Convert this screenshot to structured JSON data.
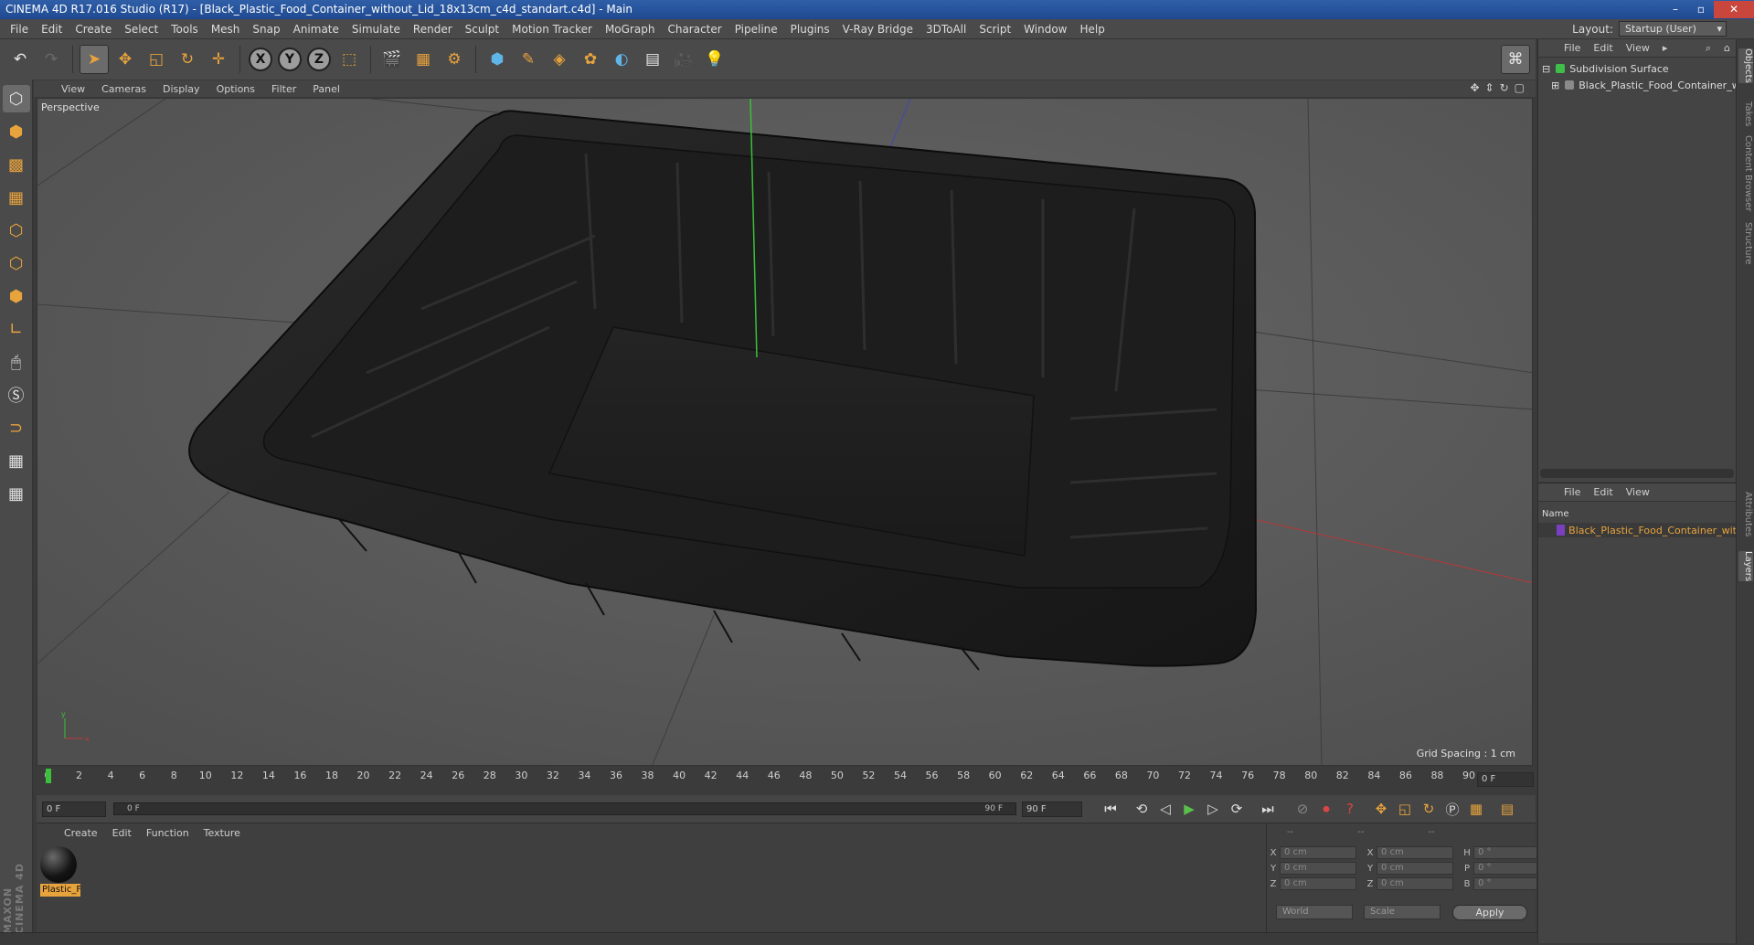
{
  "window": {
    "title": "CINEMA 4D R17.016 Studio (R17) - [Black_Plastic_Food_Container_without_Lid_18x13cm_c4d_standart.c4d] - Main"
  },
  "menu": [
    "File",
    "Edit",
    "Create",
    "Select",
    "Tools",
    "Mesh",
    "Snap",
    "Animate",
    "Simulate",
    "Render",
    "Sculpt",
    "Motion Tracker",
    "MoGraph",
    "Character",
    "Pipeline",
    "Plugins",
    "V-Ray Bridge",
    "3DToAll",
    "Script",
    "Window",
    "Help"
  ],
  "layout": {
    "label": "Layout:",
    "value": "Startup (User)"
  },
  "viewport": {
    "menu": [
      "View",
      "Cameras",
      "Display",
      "Options",
      "Filter",
      "Panel"
    ],
    "camera_label": "Perspective",
    "grid_spacing": "Grid Spacing : 1 cm"
  },
  "timeline": {
    "ticks": [
      "0",
      "2",
      "4",
      "6",
      "8",
      "10",
      "12",
      "14",
      "16",
      "18",
      "20",
      "22",
      "24",
      "26",
      "28",
      "30",
      "32",
      "34",
      "36",
      "38",
      "40",
      "42",
      "44",
      "46",
      "48",
      "50",
      "52",
      "54",
      "56",
      "58",
      "60",
      "62",
      "64",
      "66",
      "68",
      "70",
      "72",
      "74",
      "76",
      "78",
      "80",
      "82",
      "84",
      "86",
      "88",
      "90"
    ],
    "current_frame": "0 F",
    "start_field": "0 F",
    "slider_left": "0 F",
    "slider_right": "90 F",
    "end_field": "90 F"
  },
  "material_manager": {
    "menu": [
      "Create",
      "Edit",
      "Function",
      "Texture"
    ],
    "materials": [
      {
        "name": "Plastic_F"
      }
    ]
  },
  "coordinates": {
    "header": [
      "--",
      "--",
      "--"
    ],
    "rows": [
      {
        "a1": "X",
        "v1": "0 cm",
        "a2": "X",
        "v2": "0 cm",
        "a3": "H",
        "v3": "0 °"
      },
      {
        "a1": "Y",
        "v1": "0 cm",
        "a2": "Y",
        "v2": "0 cm",
        "a3": "P",
        "v3": "0 °"
      },
      {
        "a1": "Z",
        "v1": "0 cm",
        "a2": "Z",
        "v2": "0 cm",
        "a3": "B",
        "v3": "0 °"
      }
    ],
    "mode1": "World",
    "mode2": "Scale",
    "apply": "Apply"
  },
  "object_manager": {
    "menu": [
      "File",
      "Edit",
      "View"
    ],
    "objects": [
      {
        "name": "Subdivision Surface",
        "color": "#3fbf4a"
      },
      {
        "name": "Black_Plastic_Food_Container_w",
        "color": "#8a8a8a"
      }
    ]
  },
  "layers_manager": {
    "menu": [
      "File",
      "Edit",
      "View"
    ],
    "column": "Name",
    "rows": [
      {
        "name": "Black_Plastic_Food_Container_wit",
        "color": "#7a3fbf"
      }
    ]
  },
  "side_tabs": [
    "Objects",
    "Takes",
    "Content Browser",
    "Structure",
    "Attributes",
    "Layers"
  ],
  "brand": "MAXON CINEMA 4D"
}
